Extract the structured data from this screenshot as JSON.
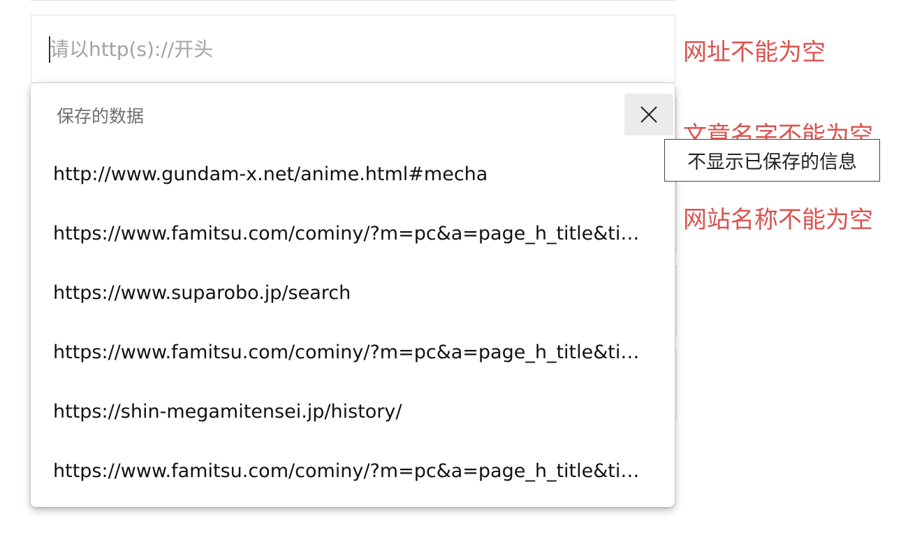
{
  "url_field": {
    "placeholder": "请以http(s)://开头",
    "value": ""
  },
  "errors": {
    "url_error": "网址不能为空",
    "article_name_error": "文章名字不能为空",
    "site_name_error": "网站名称不能为空"
  },
  "autofill": {
    "title": "保存的数据",
    "close_icon": "close-icon",
    "tooltip": "不显示已保存的信息",
    "items": [
      "http://www.gundam-x.net/anime.html#mecha",
      "https://www.famitsu.com/cominy/?m=pc&a=page_h_title&title_id=",
      "https://www.suparobo.jp/search",
      "https://www.famitsu.com/cominy/?m=pc&a=page_h_title&title_id=",
      "https://shin-megamitensei.jp/history/",
      "https://www.famitsu.com/cominy/?m=pc&a=page_h_title&title_id="
    ]
  },
  "colors": {
    "error": "#d9534f",
    "placeholder": "#a3a3a3",
    "close_button_bg": "#ebebeb"
  }
}
